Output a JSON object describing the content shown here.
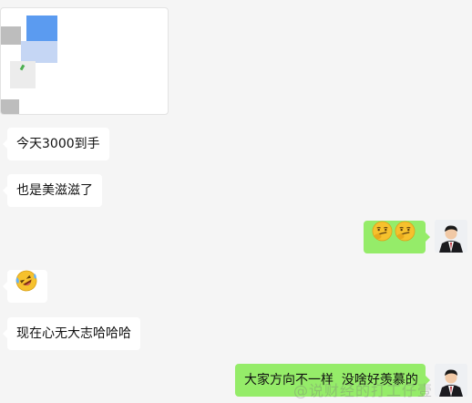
{
  "messages": {
    "m1": {
      "text": "今天3000到手"
    },
    "m2": {
      "text": "也是美滋滋了"
    },
    "m3": {
      "emoji": [
        "smirking-face",
        "smirking-face"
      ]
    },
    "m4": {
      "emoji": [
        "rolling-laughing-face"
      ]
    },
    "m5": {
      "text": "现在心无大志哈哈哈"
    },
    "m6": {
      "text": "大家方向不一样  没啥好羡慕的"
    }
  },
  "watermark": {
    "text": "@说财经的打工仔壹"
  },
  "colors": {
    "background": "#f5f5f5",
    "incoming_bubble": "#ffffff",
    "outgoing_bubble": "#95ec69",
    "emoji_yellow": "#f6c12d",
    "image_blue": "#5b9bf0"
  }
}
